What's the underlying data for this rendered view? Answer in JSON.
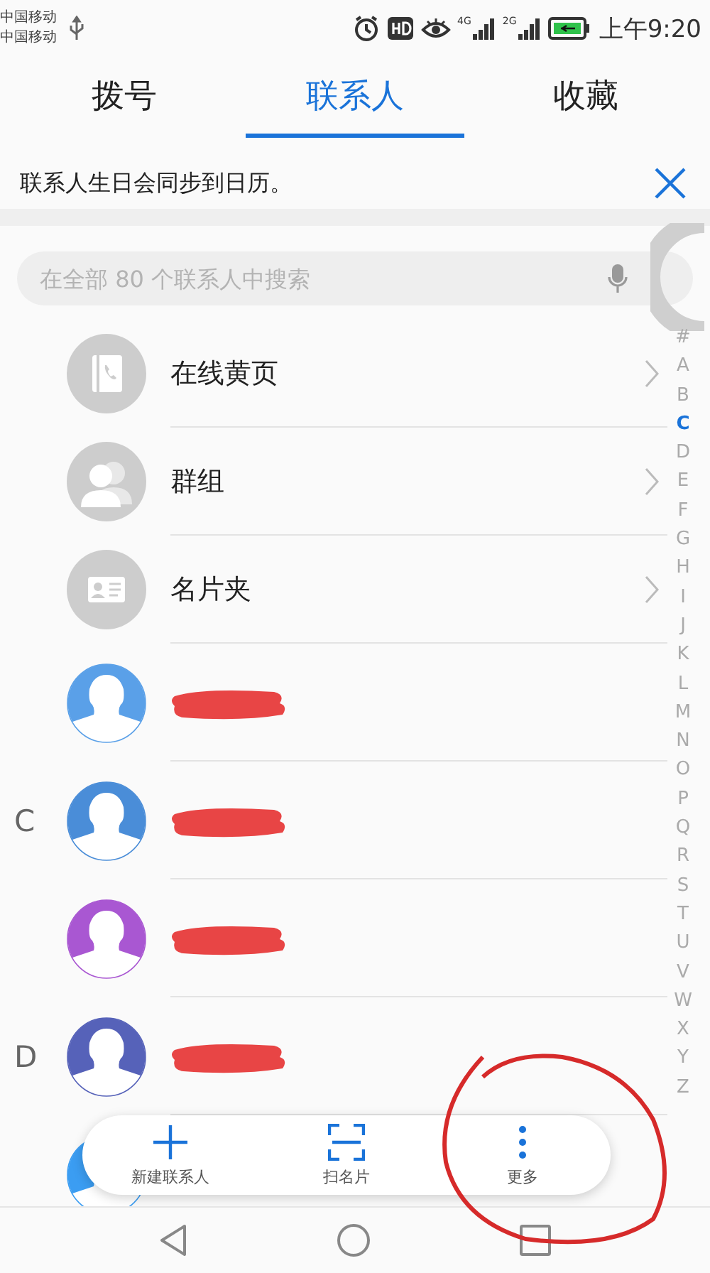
{
  "status_bar": {
    "carriers": [
      "中国移动",
      "中国移动"
    ],
    "networks": [
      "4G",
      "2G"
    ],
    "time": "上午9:20"
  },
  "tabs": [
    {
      "label": "拨号",
      "selected": false
    },
    {
      "label": "联系人",
      "selected": true
    },
    {
      "label": "收藏",
      "selected": false
    }
  ],
  "banner": {
    "text": "联系人生日会同步到日历。"
  },
  "search": {
    "placeholder": "在全部 80 个联系人中搜索"
  },
  "groups": [
    {
      "kind": "book",
      "label": "在线黄页"
    },
    {
      "kind": "people",
      "label": "群组"
    },
    {
      "kind": "card",
      "label": "名片夹"
    }
  ],
  "contacts": [
    {
      "kind": "redacted",
      "color": "#5aa0e8"
    },
    {
      "kind": "redacted",
      "section": "C",
      "color": "#4a8dd8"
    },
    {
      "kind": "redacted",
      "color": "#a957d2"
    },
    {
      "kind": "redacted",
      "section": "D",
      "color": "#5662b9"
    },
    {
      "kind": "covered",
      "color": "#3b9df2"
    }
  ],
  "index": [
    {
      "label": "#",
      "selected": false
    },
    {
      "label": "A",
      "selected": false
    },
    {
      "label": "B",
      "selected": false
    },
    {
      "label": "C",
      "selected": true
    },
    {
      "label": "D",
      "selected": false
    },
    {
      "label": "E",
      "selected": false
    },
    {
      "label": "F",
      "selected": false
    },
    {
      "label": "G",
      "selected": false
    },
    {
      "label": "H",
      "selected": false
    },
    {
      "label": "I",
      "selected": false
    },
    {
      "label": "J",
      "selected": false
    },
    {
      "label": "K",
      "selected": false
    },
    {
      "label": "L",
      "selected": false
    },
    {
      "label": "M",
      "selected": false
    },
    {
      "label": "N",
      "selected": false
    },
    {
      "label": "O",
      "selected": false
    },
    {
      "label": "P",
      "selected": false
    },
    {
      "label": "Q",
      "selected": false
    },
    {
      "label": "R",
      "selected": false
    },
    {
      "label": "S",
      "selected": false
    },
    {
      "label": "T",
      "selected": false
    },
    {
      "label": "U",
      "selected": false
    },
    {
      "label": "V",
      "selected": false
    },
    {
      "label": "W",
      "selected": false
    },
    {
      "label": "X",
      "selected": false
    },
    {
      "label": "Y",
      "selected": false
    },
    {
      "label": "Z",
      "selected": false
    }
  ],
  "actions": [
    {
      "kind": "add",
      "label": "新建联系人"
    },
    {
      "kind": "scan",
      "label": "扫名片"
    },
    {
      "kind": "more",
      "label": "更多"
    }
  ],
  "annotation": {
    "kind": "circle"
  }
}
